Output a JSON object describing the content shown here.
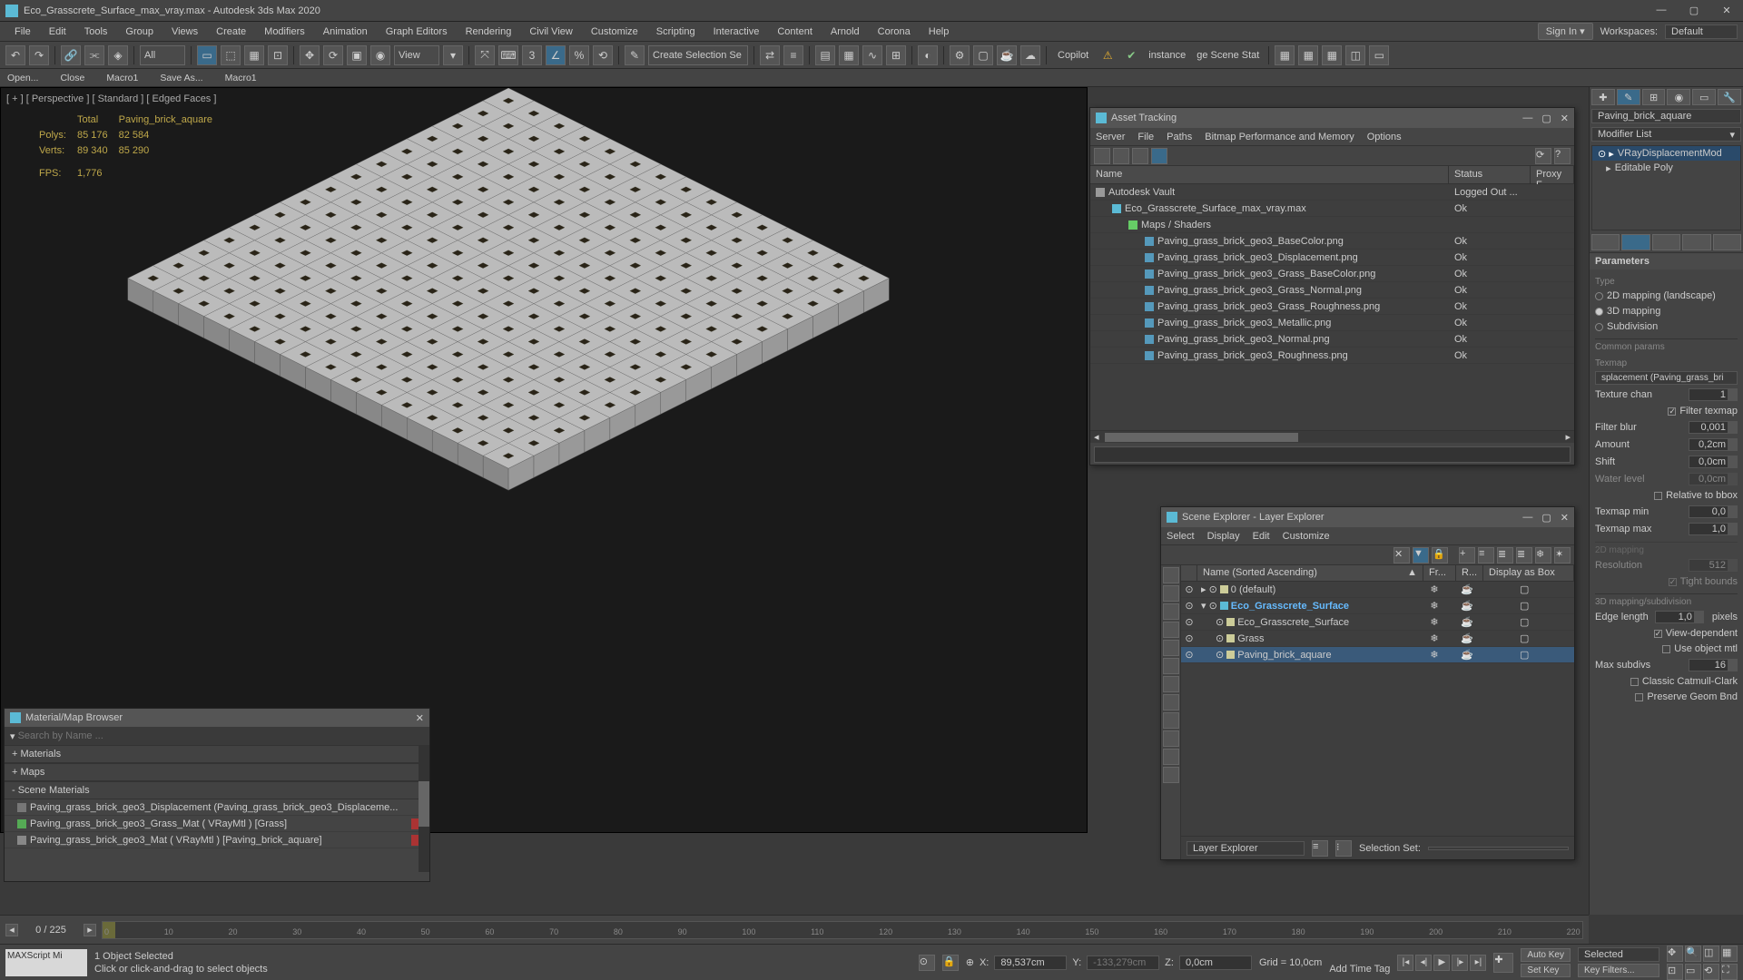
{
  "title": "Eco_Grasscrete_Surface_max_vray.max - Autodesk 3ds Max 2020",
  "menus": [
    "File",
    "Edit",
    "Tools",
    "Group",
    "Views",
    "Create",
    "Modifiers",
    "Animation",
    "Graph Editors",
    "Rendering",
    "Civil View",
    "Customize",
    "Scripting",
    "Interactive",
    "Content",
    "Arnold",
    "Corona",
    "Help"
  ],
  "signin": "Sign In",
  "workspaces_label": "Workspaces:",
  "workspace": "Default",
  "toolbar_filter": "All",
  "toolbar_view": "View",
  "toolbar_sel": "Create Selection Se",
  "toolbar_copilot": "Copilot",
  "toolbar_instance": "instance",
  "toolbar_scenestat": "ge Scene Stat",
  "quick": [
    "Open...",
    "Close",
    "Macro1",
    "Save As...",
    "Macro1"
  ],
  "vp_label": "[ + ] [ Perspective ] [ Standard ] [ Edged Faces ]",
  "hud": {
    "h_total": "Total",
    "h_obj": "Paving_brick_aquare",
    "polys_l": "Polys:",
    "polys_t": "85 176",
    "polys_o": "82 584",
    "verts_l": "Verts:",
    "verts_t": "89 340",
    "verts_o": "85 290",
    "fps_l": "FPS:",
    "fps": "1,776"
  },
  "asset": {
    "title": "Asset Tracking",
    "menus": [
      "Server",
      "File",
      "Paths",
      "Bitmap Performance and Memory",
      "Options"
    ],
    "col_name": "Name",
    "col_status": "Status",
    "col_proxy": "Proxy F",
    "rows": [
      {
        "ind": 0,
        "ic": "#999",
        "name": "Autodesk Vault",
        "status": "Logged Out ..."
      },
      {
        "ind": 1,
        "ic": "#5bbad5",
        "name": "Eco_Grasscrete_Surface_max_vray.max",
        "status": "Ok"
      },
      {
        "ind": 2,
        "ic": "#6c6",
        "name": "Maps / Shaders",
        "status": ""
      },
      {
        "ind": 3,
        "ic": "#59b",
        "name": "Paving_grass_brick_geo3_BaseColor.png",
        "status": "Ok"
      },
      {
        "ind": 3,
        "ic": "#59b",
        "name": "Paving_grass_brick_geo3_Displacement.png",
        "status": "Ok"
      },
      {
        "ind": 3,
        "ic": "#59b",
        "name": "Paving_grass_brick_geo3_Grass_BaseColor.png",
        "status": "Ok"
      },
      {
        "ind": 3,
        "ic": "#59b",
        "name": "Paving_grass_brick_geo3_Grass_Normal.png",
        "status": "Ok"
      },
      {
        "ind": 3,
        "ic": "#59b",
        "name": "Paving_grass_brick_geo3_Grass_Roughness.png",
        "status": "Ok"
      },
      {
        "ind": 3,
        "ic": "#59b",
        "name": "Paving_grass_brick_geo3_Metallic.png",
        "status": "Ok"
      },
      {
        "ind": 3,
        "ic": "#59b",
        "name": "Paving_grass_brick_geo3_Normal.png",
        "status": "Ok"
      },
      {
        "ind": 3,
        "ic": "#59b",
        "name": "Paving_grass_brick_geo3_Roughness.png",
        "status": "Ok"
      }
    ]
  },
  "scene": {
    "title": "Scene Explorer - Layer Explorer",
    "menus": [
      "Select",
      "Display",
      "Edit",
      "Customize"
    ],
    "col_name": "Name (Sorted Ascending)",
    "col_fr": "Fr...",
    "col_r": "R...",
    "col_db": "Display as Box",
    "rows": [
      {
        "ind": 0,
        "ic": "#cc9",
        "name": "0 (default)"
      },
      {
        "ind": 0,
        "ic": "#5bbad5",
        "name": "Eco_Grasscrete_Surface",
        "sel": true,
        "exp": true
      },
      {
        "ind": 1,
        "ic": "#cc9",
        "name": "Eco_Grasscrete_Surface"
      },
      {
        "ind": 1,
        "ic": "#cc9",
        "name": "Grass"
      },
      {
        "ind": 1,
        "ic": "#cc9",
        "name": "Paving_brick_aquare",
        "hl": true
      }
    ],
    "foot_mode": "Layer Explorer",
    "foot_selset": "Selection Set:"
  },
  "mat": {
    "title": "Material/Map Browser",
    "search_ph": "Search by Name ...",
    "sec1": "+ Materials",
    "sec2": "+ Maps",
    "sec3": "- Scene Materials",
    "items": [
      {
        "c": "#777",
        "t": "Paving_grass_brick_geo3_Displacement (Paving_grass_brick_geo3_Displaceme..."
      },
      {
        "c": "#5a5",
        "t": "Paving_grass_brick_geo3_Grass_Mat ( VRayMtl ) [Grass]",
        "r": true
      },
      {
        "c": "#888",
        "t": "Paving_grass_brick_geo3_Mat ( VRayMtl ) [Paving_brick_aquare]",
        "r": true
      }
    ]
  },
  "cmd": {
    "obj": "Paving_brick_aquare",
    "modlist": "Modifier List",
    "stack": [
      "VRayDisplacementMod",
      "Editable Poly"
    ],
    "params_header": "Parameters",
    "type": "Type",
    "types": [
      "2D mapping (landscape)",
      "3D mapping",
      "Subdivision"
    ],
    "common": "Common params",
    "texmap": "Texmap",
    "texmap_btn": "splacement (Paving_grass_bri",
    "p_chan": "Texture chan",
    "v_chan": "1",
    "chk_filter": "Filter texmap",
    "p_blur": "Filter blur",
    "v_blur": "0,001",
    "p_amt": "Amount",
    "v_amt": "0,2cm",
    "p_shift": "Shift",
    "v_shift": "0,0cm",
    "p_water": "Water level",
    "v_water": "0,0cm",
    "chk_bbox": "Relative to bbox",
    "p_tmin": "Texmap min",
    "v_tmin": "0,0",
    "p_tmax": "Texmap max",
    "v_tmax": "1,0",
    "sec_2d": "2D mapping",
    "p_res": "Resolution",
    "v_res": "512",
    "chk_tight": "Tight bounds",
    "sec_3d": "3D mapping/subdivision",
    "p_edge": "Edge length",
    "v_edge": "1,0",
    "u_edge": "pixels",
    "chk_vdep": "View-dependent",
    "chk_uobj": "Use object mtl",
    "p_maxsub": "Max subdivs",
    "v_maxsub": "16",
    "chk_cc": "Classic Catmull-Clark",
    "chk_pgb": "Preserve Geom Bnd"
  },
  "timeline": {
    "frame": "0 / 225",
    "ticks": [
      "0",
      "10",
      "20",
      "30",
      "40",
      "50",
      "60",
      "70",
      "80",
      "90",
      "100",
      "110",
      "120",
      "130",
      "140",
      "150",
      "160",
      "170",
      "180",
      "190",
      "200",
      "210",
      "220"
    ]
  },
  "status": {
    "maxscript": "MAXScript Mi",
    "selcount": "1 Object Selected",
    "hint": "Click or click-and-drag to select objects",
    "x_l": "X:",
    "x": "89,537cm",
    "y_l": "Y:",
    "y": "-133,279cm",
    "z_l": "Z:",
    "z": "0,0cm",
    "grid": "Grid = 10,0cm",
    "addtag": "Add Time Tag",
    "autokey": "Auto Key",
    "setkey": "Set Key",
    "selected": "Selected",
    "keyfilters": "Key Filters..."
  }
}
